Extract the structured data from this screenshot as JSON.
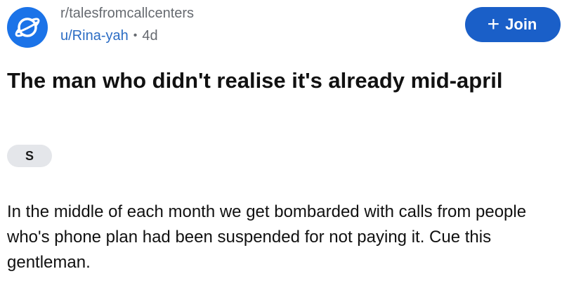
{
  "post": {
    "subreddit": "r/talesfromcallcenters",
    "username": "u/Rina-yah",
    "separator": "•",
    "age": "4d",
    "join_plus": "+",
    "join_label": "Join",
    "title": "The man who didn't realise it's already mid-april",
    "flair": "S",
    "body": "In the middle of each month we get bombarded with calls from people who's phone plan had been suspended for not paying it. Cue this gentleman.",
    "icon": "planet-icon"
  },
  "colors": {
    "accent": "#1a5fc8",
    "avatar": "#1b73e8",
    "username": "#2b6cc4",
    "muted": "#666a70",
    "flair_bg": "#e4e6ea"
  }
}
